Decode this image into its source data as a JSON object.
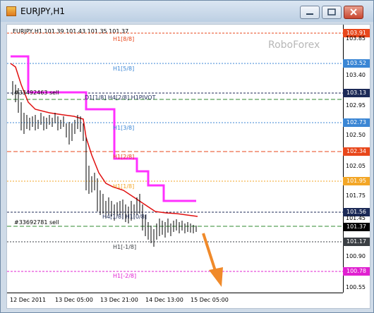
{
  "window": {
    "title": "EURJPY,H1"
  },
  "header": {
    "ohlc": "EURJPY,H1  101.39 101.43 101.35 101.37"
  },
  "watermark": "RoboForex",
  "price_scale": [
    {
      "label": "103.91",
      "kind": "box",
      "color": "#e8471b"
    },
    {
      "label": "103.85",
      "kind": "plain"
    },
    {
      "label": "103.52",
      "kind": "box",
      "color": "#3b86d4"
    },
    {
      "label": "103.40",
      "kind": "plain"
    },
    {
      "label": "103.13",
      "kind": "box",
      "color": "#1c2a57"
    },
    {
      "label": "102.95",
      "kind": "plain"
    },
    {
      "label": "102.73",
      "kind": "box",
      "color": "#3b86d4"
    },
    {
      "label": "102.50",
      "kind": "plain"
    },
    {
      "label": "102.34",
      "kind": "box",
      "color": "#e8471b"
    },
    {
      "label": "102.05",
      "kind": "plain"
    },
    {
      "label": "101.95",
      "kind": "box",
      "color": "#f3a626"
    },
    {
      "label": "101.75",
      "kind": "plain"
    },
    {
      "label": "101.56",
      "kind": "box",
      "color": "#1c2a57"
    },
    {
      "label": "101.45",
      "kind": "plain"
    },
    {
      "label": "101.37",
      "kind": "box",
      "color": "#000000"
    },
    {
      "label": "101.17",
      "kind": "box",
      "color": "#3b3f44"
    },
    {
      "label": "100.90",
      "kind": "plain"
    },
    {
      "label": "100.78",
      "kind": "box",
      "color": "#e020d0"
    },
    {
      "label": "100.55",
      "kind": "plain"
    }
  ],
  "levels": [
    {
      "label": "H1[8/8]",
      "color": "#e8471b"
    },
    {
      "label": "H1[5/8]",
      "color": "#3b86d4"
    },
    {
      "label": "D1[1/8] H4[2/8] H1PIVOT",
      "color": "#1c2a57"
    },
    {
      "label": "H1[3/8]",
      "color": "#3b86d4"
    },
    {
      "label": "H1[2/8]",
      "color": "#e8471b"
    },
    {
      "label": "H1[1/8]",
      "color": "#f3a626"
    },
    {
      "label": "H4[1/8] H1[0/8]",
      "color": "#1c2a57"
    },
    {
      "label": "H1[-1/8]",
      "color": "#3b3f44"
    },
    {
      "label": "H1[-2/8]",
      "color": "#e020d0"
    }
  ],
  "orders": [
    {
      "label": "#33492463 sell"
    },
    {
      "label": "#33692781 sell"
    }
  ],
  "time_axis": [
    "12 Dec 2011",
    "13 Dec 05:00",
    "13 Dec 21:00",
    "14 Dec 13:00",
    "15 Dec 05:00"
  ],
  "colors": {
    "magenta_line": "#ff30ff",
    "red_line": "#e01010",
    "candle": "#000000",
    "arrow": "#f08a2a"
  }
}
